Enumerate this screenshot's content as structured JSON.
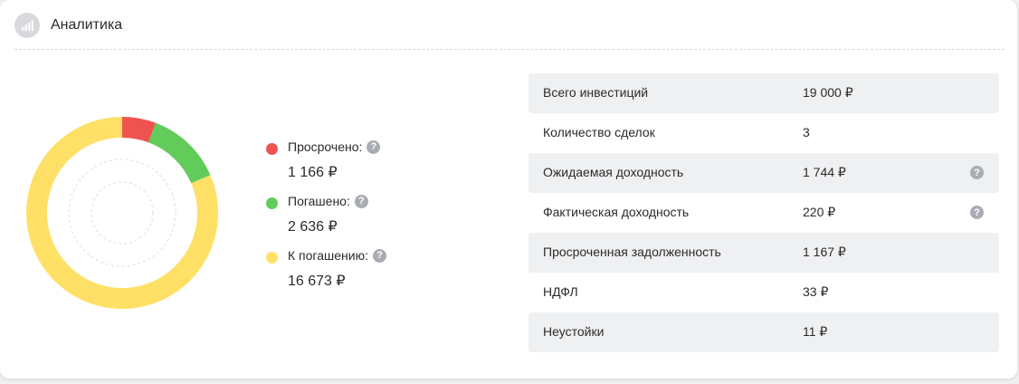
{
  "header": {
    "title": "Аналитика",
    "icon": "bar-chart-icon"
  },
  "chart_data": {
    "type": "pie",
    "style": "donut",
    "series": [
      {
        "name": "Просрочено:",
        "value": 1166,
        "display": "1 166 ₽",
        "color": "#ef5350"
      },
      {
        "name": "Погашено:",
        "value": 2636,
        "display": "2 636 ₽",
        "color": "#62cc5b"
      },
      {
        "name": "К погашению:",
        "value": 16673,
        "display": "16 673 ₽",
        "color": "#ffe066"
      }
    ]
  },
  "stats": [
    {
      "label": "Всего инвестиций",
      "value": "19 000 ₽",
      "help": false
    },
    {
      "label": "Количество сделок",
      "value": "3",
      "help": false
    },
    {
      "label": "Ожидаемая доходность",
      "value": "1 744 ₽",
      "help": true
    },
    {
      "label": "Фактическая доходность",
      "value": "220 ₽",
      "help": true
    },
    {
      "label": "Просроченная задолженность",
      "value": "1 167 ₽",
      "help": false
    },
    {
      "label": "НДФЛ",
      "value": "33 ₽",
      "help": false
    },
    {
      "label": "Неустойки",
      "value": "11 ₽",
      "help": false
    }
  ],
  "help_glyph": "?"
}
